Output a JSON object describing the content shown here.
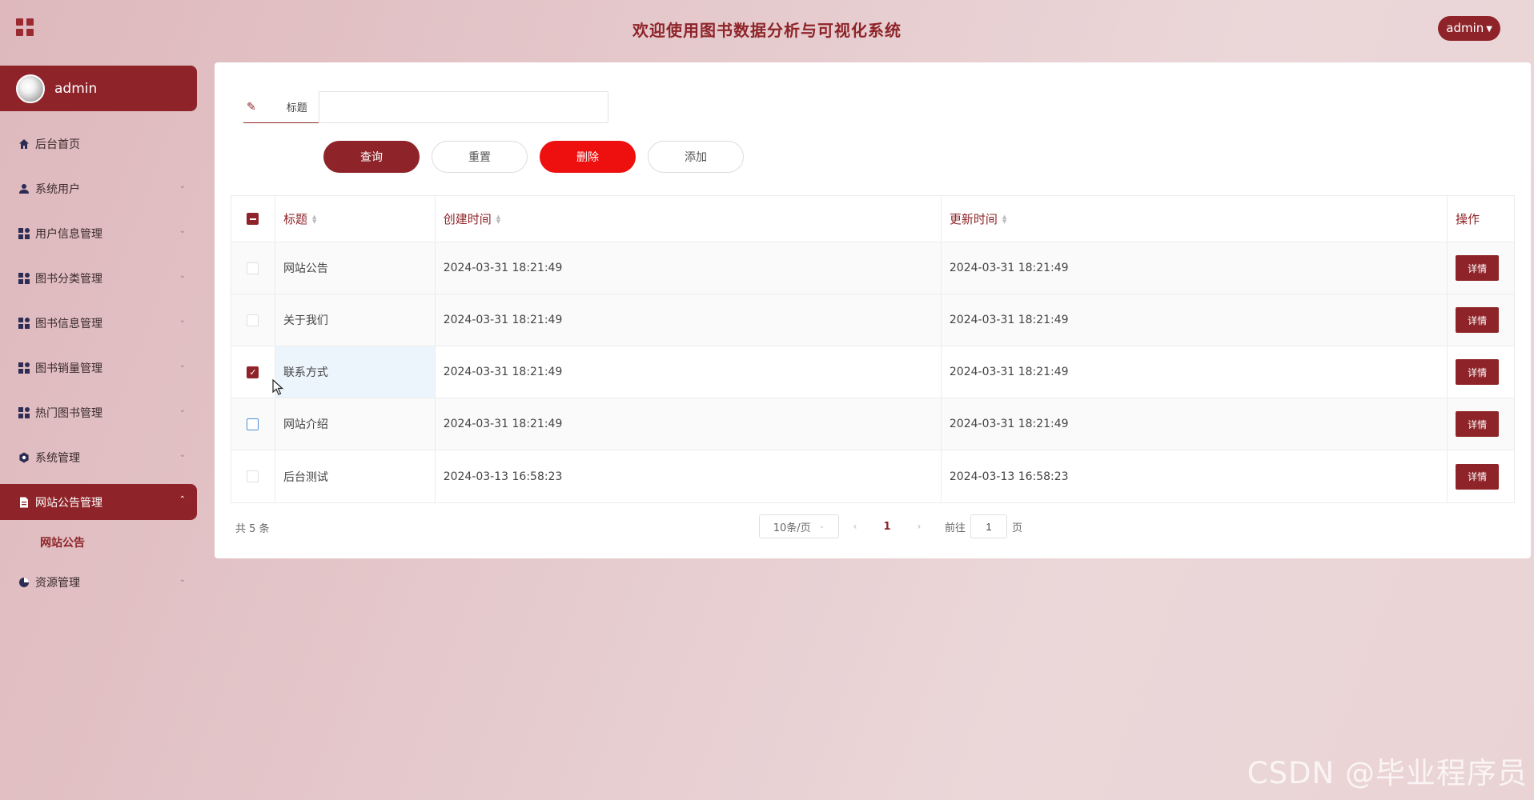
{
  "header": {
    "title": "欢迎使用图书数据分析与可视化系统",
    "user_label": "admin",
    "menu_icon": "grid-icon"
  },
  "sidebar": {
    "profile_name": "admin",
    "items": [
      {
        "label": "后台首页",
        "icon": "home-icon"
      },
      {
        "label": "系统用户",
        "icon": "user-icon"
      },
      {
        "label": "用户信息管理",
        "icon": "dashboard-icon"
      },
      {
        "label": "图书分类管理",
        "icon": "dashboard-icon"
      },
      {
        "label": "图书信息管理",
        "icon": "dashboard-icon"
      },
      {
        "label": "图书销量管理",
        "icon": "dashboard-icon"
      },
      {
        "label": "热门图书管理",
        "icon": "dashboard-icon"
      },
      {
        "label": "系统管理",
        "icon": "gear-icon"
      },
      {
        "label": "网站公告管理",
        "icon": "document-icon"
      },
      {
        "label": "资源管理",
        "icon": "pie-chart-icon"
      }
    ],
    "submenu": {
      "label": "网站公告"
    }
  },
  "search": {
    "label": "标题",
    "value": "",
    "placeholder": ""
  },
  "buttons": {
    "query": "查询",
    "reset": "重置",
    "delete": "删除",
    "add": "添加"
  },
  "table": {
    "columns": [
      "标题",
      "创建时间",
      "更新时间",
      "操作"
    ],
    "rows": [
      {
        "title": "网站公告",
        "created": "2024-03-31 18:21:49",
        "updated": "2024-03-31 18:21:49",
        "action": "详情",
        "checked": false
      },
      {
        "title": "关于我们",
        "created": "2024-03-31 18:21:49",
        "updated": "2024-03-31 18:21:49",
        "action": "详情",
        "checked": false
      },
      {
        "title": "联系方式",
        "created": "2024-03-31 18:21:49",
        "updated": "2024-03-31 18:21:49",
        "action": "详情",
        "checked": true
      },
      {
        "title": "网站介绍",
        "created": "2024-03-31 18:21:49",
        "updated": "2024-03-31 18:21:49",
        "action": "详情",
        "checked": false
      },
      {
        "title": "后台测试",
        "created": "2024-03-13 16:58:23",
        "updated": "2024-03-13 16:58:23",
        "action": "详情",
        "checked": false
      }
    ]
  },
  "pagination": {
    "total": "共 5 条",
    "page_size": "10条/页",
    "current_page": "1",
    "goto_prefix": "前往",
    "goto_value": "1",
    "goto_suffix": "页"
  },
  "watermark": "CSDN @毕业程序员",
  "colors": {
    "accent": "#8e2429",
    "danger": "#ee0f0f"
  }
}
